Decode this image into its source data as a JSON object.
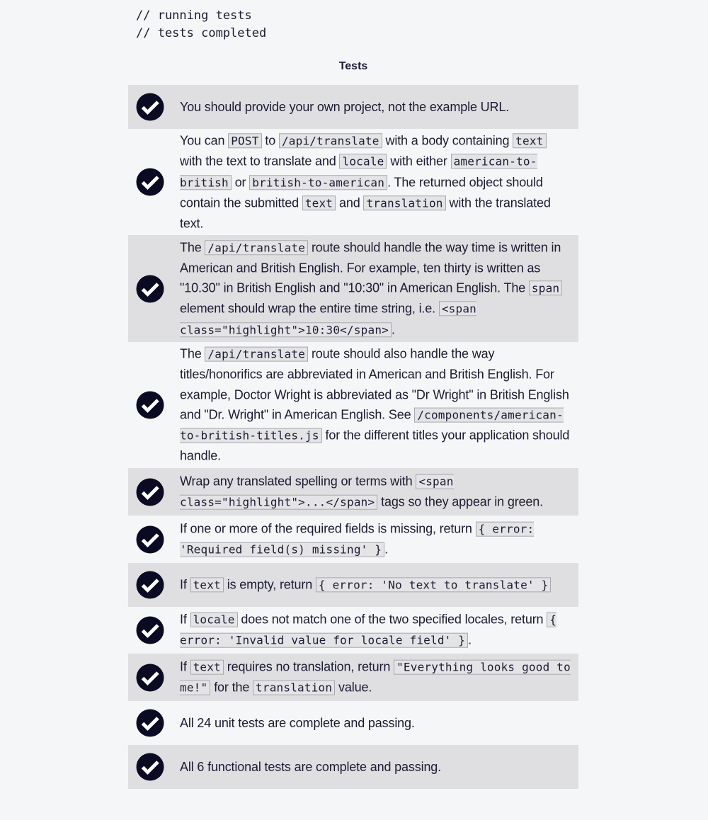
{
  "console": {
    "line1": "// running tests",
    "line2": "// tests completed"
  },
  "heading": "Tests",
  "tests": [
    {
      "status": "passed",
      "icon": "check-circle-icon",
      "segments": [
        {
          "t": "text",
          "v": "You should provide your own project, not the example URL."
        }
      ]
    },
    {
      "status": "passed",
      "icon": "check-circle-icon",
      "segments": [
        {
          "t": "text",
          "v": "You can "
        },
        {
          "t": "code",
          "v": "POST"
        },
        {
          "t": "text",
          "v": " to "
        },
        {
          "t": "code",
          "v": "/api/translate"
        },
        {
          "t": "text",
          "v": " with a body containing "
        },
        {
          "t": "code",
          "v": "text"
        },
        {
          "t": "text",
          "v": " with the text to translate and "
        },
        {
          "t": "code",
          "v": "locale"
        },
        {
          "t": "text",
          "v": " with either "
        },
        {
          "t": "code",
          "v": "american-to-british"
        },
        {
          "t": "text",
          "v": " or "
        },
        {
          "t": "code",
          "v": "british-to-american"
        },
        {
          "t": "text",
          "v": ". The returned object should contain the submitted "
        },
        {
          "t": "code",
          "v": "text"
        },
        {
          "t": "text",
          "v": " and "
        },
        {
          "t": "code",
          "v": "translation"
        },
        {
          "t": "text",
          "v": " with the translated text."
        }
      ]
    },
    {
      "status": "passed",
      "icon": "check-circle-icon",
      "segments": [
        {
          "t": "text",
          "v": "The "
        },
        {
          "t": "code",
          "v": "/api/translate"
        },
        {
          "t": "text",
          "v": " route should handle the way time is written in American and British English. For example, ten thirty is written as \"10.30\" in British English and \"10:30\" in American English. The "
        },
        {
          "t": "code",
          "v": "span"
        },
        {
          "t": "text",
          "v": " element should wrap the entire time string, i.e. "
        },
        {
          "t": "code",
          "v": "<span class=\"highlight\">10:30</span>"
        },
        {
          "t": "text",
          "v": "."
        }
      ]
    },
    {
      "status": "passed",
      "icon": "check-circle-icon",
      "segments": [
        {
          "t": "text",
          "v": "The "
        },
        {
          "t": "code",
          "v": "/api/translate"
        },
        {
          "t": "text",
          "v": " route should also handle the way titles/honorifics are abbreviated in American and British English. For example, Doctor Wright is abbreviated as \"Dr Wright\" in British English and \"Dr. Wright\" in American English. See "
        },
        {
          "t": "code",
          "v": "/components/american-to-british-titles.js"
        },
        {
          "t": "text",
          "v": " for the different titles your application should handle."
        }
      ]
    },
    {
      "status": "passed",
      "icon": "check-circle-icon",
      "segments": [
        {
          "t": "text",
          "v": "Wrap any translated spelling or terms with "
        },
        {
          "t": "code",
          "v": "<span class=\"highlight\">...</span>"
        },
        {
          "t": "text",
          "v": " tags so they appear in green."
        }
      ]
    },
    {
      "status": "passed",
      "icon": "check-circle-icon",
      "segments": [
        {
          "t": "text",
          "v": "If one or more of the required fields is missing, return "
        },
        {
          "t": "code",
          "v": "{ error: 'Required field(s) missing' }"
        },
        {
          "t": "text",
          "v": "."
        }
      ]
    },
    {
      "status": "passed",
      "icon": "check-circle-icon",
      "segments": [
        {
          "t": "text",
          "v": "If "
        },
        {
          "t": "code",
          "v": "text"
        },
        {
          "t": "text",
          "v": " is empty, return "
        },
        {
          "t": "code",
          "v": "{ error: 'No text to translate' }"
        }
      ]
    },
    {
      "status": "passed",
      "icon": "check-circle-icon",
      "segments": [
        {
          "t": "text",
          "v": "If "
        },
        {
          "t": "code",
          "v": "locale"
        },
        {
          "t": "text",
          "v": " does not match one of the two specified locales, return "
        },
        {
          "t": "code",
          "v": "{ error: 'Invalid value for locale field' }"
        },
        {
          "t": "text",
          "v": "."
        }
      ]
    },
    {
      "status": "passed",
      "icon": "check-circle-icon",
      "segments": [
        {
          "t": "text",
          "v": "If "
        },
        {
          "t": "code",
          "v": "text"
        },
        {
          "t": "text",
          "v": " requires no translation, return "
        },
        {
          "t": "code",
          "v": "\"Everything looks good to me!\""
        },
        {
          "t": "text",
          "v": " for the "
        },
        {
          "t": "code",
          "v": "translation"
        },
        {
          "t": "text",
          "v": " value."
        }
      ]
    },
    {
      "status": "passed",
      "icon": "check-circle-icon",
      "segments": [
        {
          "t": "text",
          "v": "All 24 unit tests are complete and passing."
        }
      ]
    },
    {
      "status": "passed",
      "icon": "check-circle-icon",
      "segments": [
        {
          "t": "text",
          "v": "All 6 functional tests are complete and passing."
        }
      ]
    }
  ]
}
